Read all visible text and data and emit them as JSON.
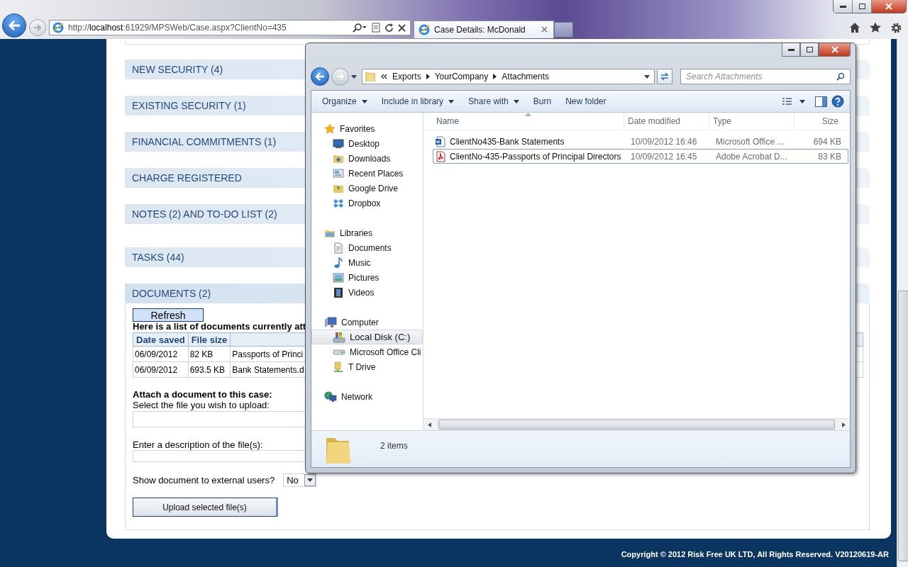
{
  "browser": {
    "address": "http://**localhost**:61929/MPSWeb/Case.aspx?ClientNo=435",
    "tabs": [
      {
        "title": "Case Details: McDonald",
        "selected": true
      }
    ]
  },
  "sections": [
    {
      "title": "NEW SECURITY (4)"
    },
    {
      "title": "EXISTING SECURITY (1)"
    },
    {
      "title": "FINANCIAL COMMITMENTS (1)"
    },
    {
      "title": "CHARGE REGISTERED"
    },
    {
      "title": "NOTES (2) AND TO-DO LIST (2)"
    },
    {
      "title": "TASKS (44)"
    },
    {
      "title": "DOCUMENTS (2)",
      "documents": {
        "refresh": "Refresh",
        "intro": "Here is a list of documents currently att",
        "columns": [
          "Date saved",
          "File size"
        ],
        "rows": [
          [
            "06/09/2012",
            "82 KB",
            "Passports of Princi"
          ],
          [
            "06/09/2012",
            "693.5 KB",
            "Bank Statements.d"
          ]
        ],
        "attach_title": "Attach a document to this case:",
        "file_label": "Select the file you wish to upload:",
        "description_label": "Enter a description of the file(s):",
        "external_label": "Show document to external users?",
        "external_value": "No",
        "upload": "Upload selected file(s)"
      }
    }
  ],
  "footer": "Copyright © 2012 Risk Free UK LTD, All Rights Reserved. V20120619-AR",
  "explorer": {
    "breadcrumb": [
      "Exports",
      "YourCompany",
      "Attachments"
    ],
    "search_placeholder": "Search Attachments",
    "toolbar": [
      {
        "label": "Organize",
        "menu": true
      },
      {
        "label": "Include in library",
        "menu": true
      },
      {
        "label": "Share with",
        "menu": true
      },
      {
        "label": "Burn",
        "menu": false
      },
      {
        "label": "New folder",
        "menu": false
      }
    ],
    "nav": [
      {
        "label": "Favorites",
        "selected": false,
        "children": [
          {
            "label": "Desktop",
            "selected": false
          },
          {
            "label": "Downloads",
            "selected": false
          },
          {
            "label": "Recent Places",
            "selected": false
          },
          {
            "label": "Google Drive",
            "selected": false
          },
          {
            "label": "Dropbox",
            "selected": false
          }
        ]
      },
      {
        "label": "Libraries",
        "selected": false,
        "children": [
          {
            "label": "Documents",
            "selected": false
          },
          {
            "label": "Music",
            "selected": false
          },
          {
            "label": "Pictures",
            "selected": false
          },
          {
            "label": "Videos",
            "selected": false
          }
        ]
      },
      {
        "label": "Computer",
        "selected": false,
        "children": [
          {
            "label": "Local Disk (C:)",
            "selected": true
          },
          {
            "label": "Microsoft Office Cli",
            "selected": false
          },
          {
            "label": "T Drive",
            "selected": false
          }
        ]
      },
      {
        "label": "Network",
        "selected": false
      }
    ],
    "columns": [
      "Name",
      "Date modified",
      "Type",
      "Size"
    ],
    "files": [
      {
        "name": "ClientNo435-Bank Statements",
        "date": "10/09/2012 16:46",
        "type": "Microsoft Office ...",
        "size": "694 KB",
        "kind": "word",
        "focused": false
      },
      {
        "name": "ClientNo-435-Passports of Principal Directors",
        "date": "10/09/2012 16:45",
        "type": "Adobe Acrobat D...",
        "size": "83 KB",
        "kind": "pdf",
        "focused": true
      }
    ],
    "status": "2 items"
  }
}
